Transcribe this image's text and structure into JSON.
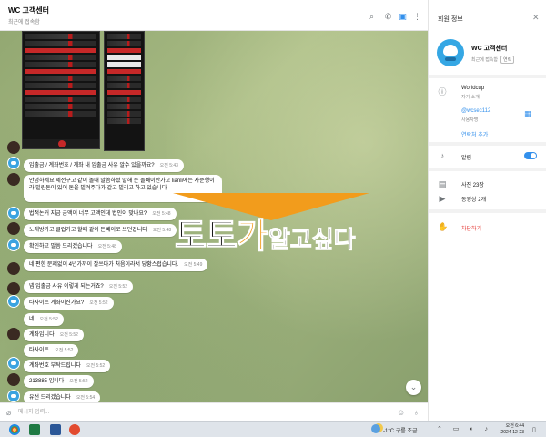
{
  "header": {
    "title": "WC 고객센터",
    "status": "최근에 접속함"
  },
  "messages": [
    {
      "text": "입출금 / 계좌번호 / 계좌 내 입출금 사유 알수 있을까요?",
      "time": "오전 5:43"
    },
    {
      "text": "안녕하세요 제전구고 같이 놀때 말씀하셨 말해 돈 돌빼이안가고 lianli에는 사준행이라 빌린돈이 있어 돈을 빌려주다가 같고 빌리고 하고 있습니다",
      "time": "오전 5:45"
    },
    {
      "text": "법적논거 지금 금액이 너무 고액인데 법인이 맞나요?",
      "time": "오전 5:48"
    },
    {
      "text": "노래방가고 클럽가고 할때 같이 돈빼이로 쓰던겁니다",
      "time": "오전 5:48"
    },
    {
      "text": "확인하고 말씀 드리겠습니다",
      "time": "오전 5:48"
    },
    {
      "text": "네 편한 문제없이 4년가까이 잘쓰다가 처음이라서 당황스럽습니다.",
      "time": "오전 5:49"
    },
    {
      "text": "넵 입출금 사유 이렇게 되는거죠?",
      "time": "오전 5:52"
    },
    {
      "text": "타사이트 계좌이신가요?",
      "time": "오전 5:52"
    },
    {
      "text": "네",
      "time": "오전 5:52"
    },
    {
      "text": "계좌입니다",
      "time": "오전 5:52"
    },
    {
      "text": "타사이트",
      "time": "오전 5:52"
    },
    {
      "text": "계좌번호 부탁드립니다",
      "time": "오전 5:52"
    },
    {
      "text": "213885 입니다",
      "time": "오전 5:52"
    },
    {
      "text": "유선 드리겠습니다",
      "time": "오전 5:54"
    }
  ],
  "watermark": {
    "part1": "토토",
    "part2": "가",
    "part3": "알고싶다"
  },
  "composer": {
    "placeholder": "메시지 입력..."
  },
  "panel": {
    "title": "회원 정보",
    "name": "WC 고객센터",
    "last_seen": "최근에 접속함",
    "badge": "연락",
    "bio_main": "Worldcup",
    "bio_sub": "자기 소개",
    "username": "@wcsec112",
    "username_label": "사용자명",
    "add_contact": "연락처 추가",
    "notifications": "알림",
    "photos": "사진 23장",
    "videos": "동영상 2개",
    "block": "차단하기"
  },
  "taskbar": {
    "weather": "-1°C  구름 조금",
    "time": "오전 6:44",
    "date": "2024-12-23"
  },
  "colors": {
    "accent": "#3390ec",
    "danger": "#e53935",
    "watermark_orange": "#f29c1c"
  }
}
